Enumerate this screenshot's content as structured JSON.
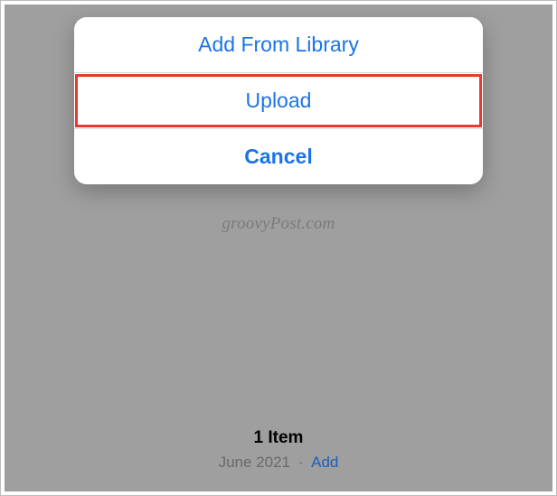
{
  "sheet": {
    "add_from_library": "Add From Library",
    "upload": "Upload",
    "cancel": "Cancel"
  },
  "watermark": "groovyPost.com",
  "footer": {
    "count_label": "1 Item",
    "date_label": "June 2021",
    "separator": "·",
    "add_label": "Add"
  }
}
